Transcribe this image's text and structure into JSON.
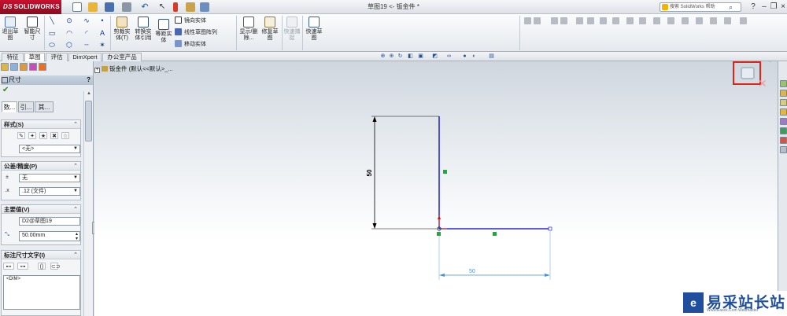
{
  "app": {
    "logo_brand": "SOLIDWORKS",
    "logo_mark": "DS",
    "document_title": "草图19 <- 钣金件 *",
    "help_search_placeholder": "搜索 SolidWorks 帮助",
    "colors": {
      "accent_red": "#c8102e",
      "sketch_blue": "#0000cc",
      "relation_green": "#1cab3c",
      "highlight_box": "#e2231a"
    }
  },
  "ribbon": {
    "exit_sketch": "退出草图",
    "smart_dimension": "智能尺寸",
    "trim_entities": "剪裁实体(T)",
    "convert_entities": "转换实体引用",
    "offset_entities": "等距实体",
    "mirror_entities": "镜向实体",
    "linear_pattern": "线性草图阵列",
    "move_entities": "移动实体",
    "display_delete_relations": "显示/删除...",
    "repair_sketch": "修复草图",
    "quick_snaps": "快速捕捉",
    "rapid_sketch": "快速草图"
  },
  "tabs": [
    {
      "label": "特征"
    },
    {
      "label": "草图"
    },
    {
      "label": "评估"
    },
    {
      "label": "DimXpert"
    },
    {
      "label": "办公室产品"
    }
  ],
  "property_manager": {
    "title": "尺寸",
    "help": "?",
    "subtabs": [
      "数...",
      "引...",
      "其..."
    ],
    "style_group": {
      "title": "样式(S)",
      "value": "<无>"
    },
    "tolerance_group": {
      "title": "公差/精度(P)",
      "tolerance_value": "无",
      "precision_value": ".12 (文件)"
    },
    "primary_value_group": {
      "title": "主要值(V)",
      "name": "D2@草图19",
      "value": "50.00mm"
    },
    "dimension_text_group": {
      "title": "标注尺寸文字(I)",
      "text": "<DIM>"
    }
  },
  "graphics": {
    "tree_root": "钣金件 (默认<<默认>_..."
  },
  "chart_data": {
    "type": "sketch",
    "dimensions": [
      {
        "label": "50",
        "orientation": "vertical"
      },
      {
        "label": "50",
        "orientation": "horizontal"
      }
    ]
  },
  "watermark": {
    "text": "易采站长站",
    "sub": "Www.Easck.Com Webmaster"
  }
}
